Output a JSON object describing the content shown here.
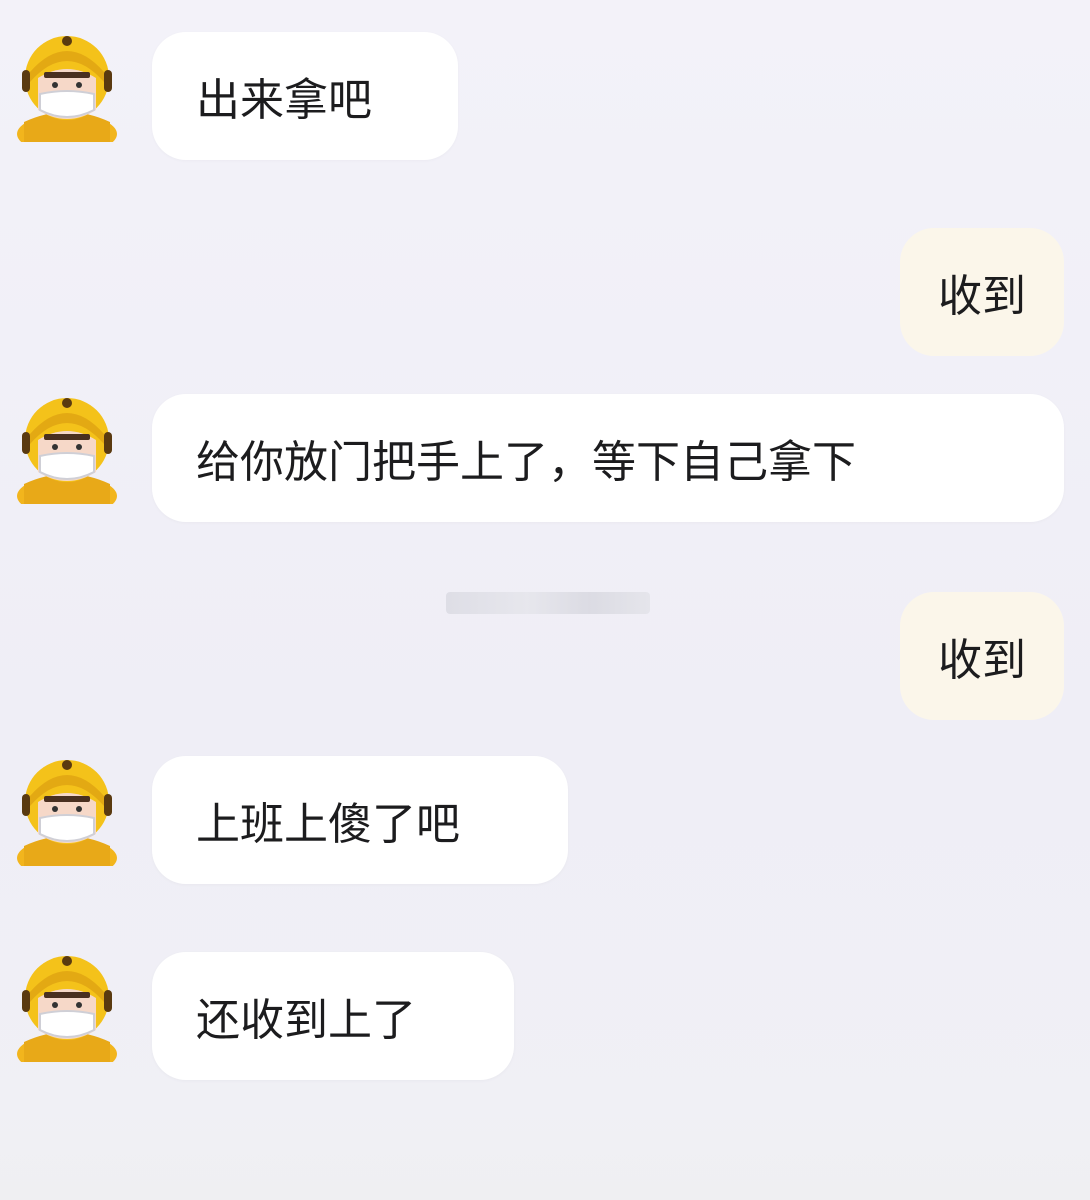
{
  "chat": {
    "messages": [
      {
        "side": "incoming",
        "sender": "courier",
        "text": "出来拿吧"
      },
      {
        "side": "outgoing",
        "sender": "me",
        "text": "收到"
      },
      {
        "side": "incoming",
        "sender": "courier",
        "text": "给你放门把手上了，等下自己拿下"
      },
      {
        "side": "outgoing",
        "sender": "me",
        "text": "收到"
      },
      {
        "side": "incoming",
        "sender": "courier",
        "text": "上班上傻了吧"
      },
      {
        "side": "incoming",
        "sender": "courier",
        "text": "还收到上了"
      }
    ]
  },
  "avatar": {
    "icon": "courier-avatar-icon",
    "colors": {
      "helmet": "#f4c21a",
      "helmet_dark": "#e3a913",
      "skin": "#f6d8c8",
      "mask": "#ffffff",
      "body": "#f2b51d"
    }
  },
  "colors": {
    "background": "#f1f0f7",
    "incoming_bubble": "#ffffff",
    "outgoing_bubble": "#fbf6ea",
    "text": "#1c1c1e"
  }
}
